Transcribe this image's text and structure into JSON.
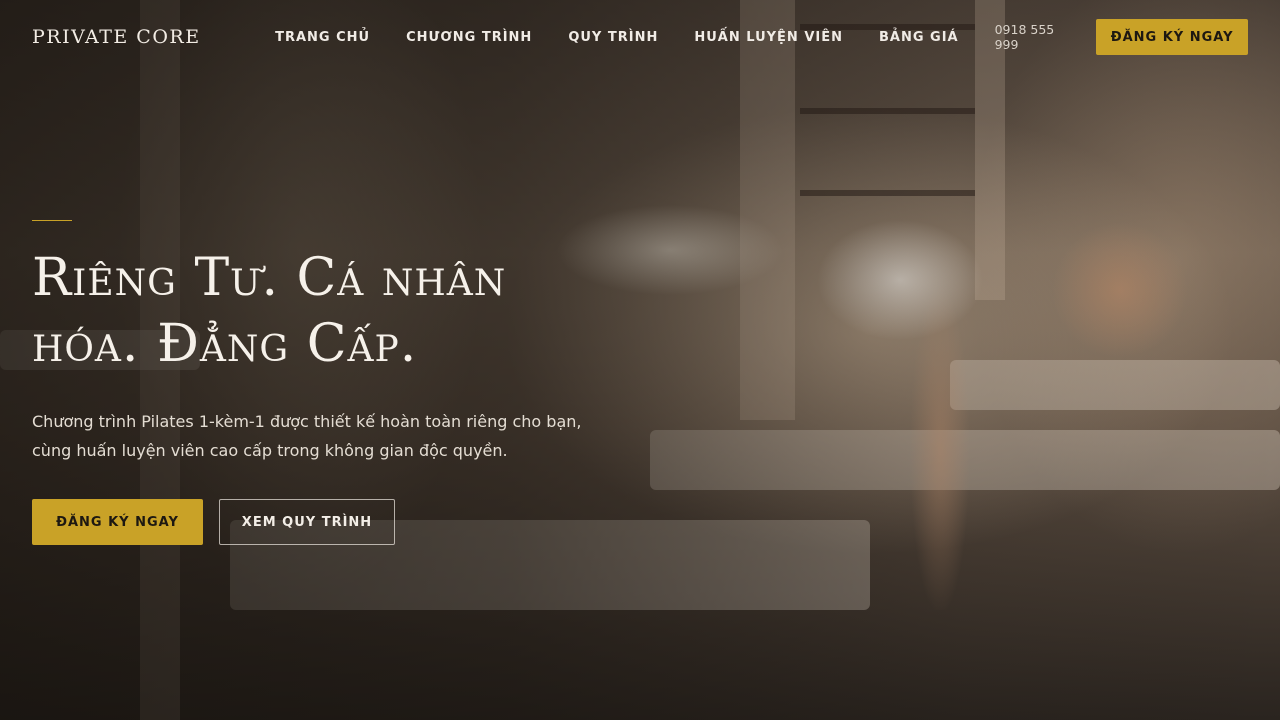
{
  "header": {
    "logo": "PRIVATE CORE",
    "nav": [
      {
        "label": "TRANG CHỦ"
      },
      {
        "label": "CHƯƠNG TRÌNH"
      },
      {
        "label": "QUY TRÌNH"
      },
      {
        "label": "HUẤN LUYỆN VIÊN"
      },
      {
        "label": "BẢNG GIÁ"
      }
    ],
    "phone": "0918 555 999",
    "cta_label": "ĐĂNG KÝ NGAY"
  },
  "hero": {
    "title": "Riêng Tư. Cá nhân hóa. Đẳng Cấp.",
    "subtitle": "Chương trình Pilates 1-kèm-1 được thiết kế hoàn toàn riêng cho bạn, cùng huấn luyện viên cao cấp trong không gian độc quyền.",
    "primary_cta": "ĐĂNG KÝ NGAY",
    "secondary_cta": "XEM QUY TRÌNH"
  },
  "colors": {
    "accent": "#c9a227",
    "text_light": "#f6f1ea"
  }
}
